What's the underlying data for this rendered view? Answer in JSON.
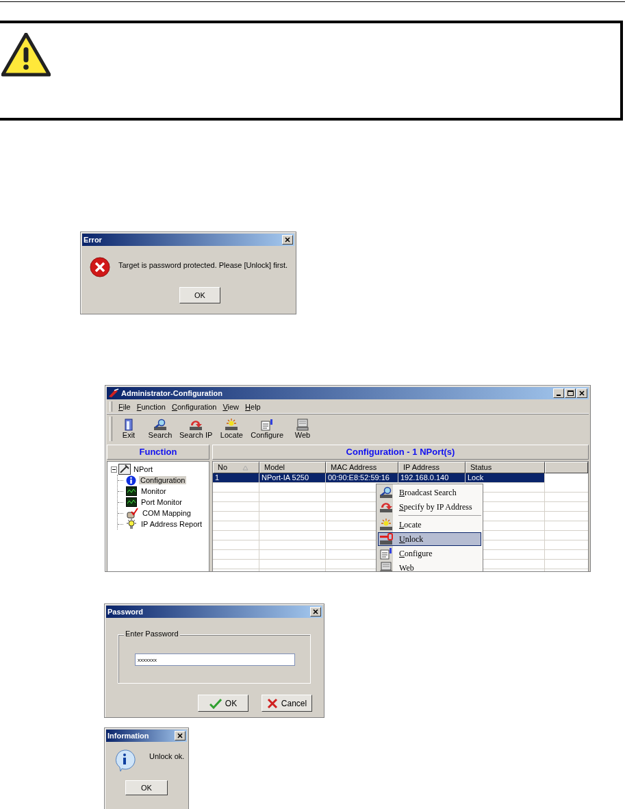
{
  "error_dialog": {
    "title": "Error",
    "message": "Target is password protected. Please [Unlock] first.",
    "button": "OK"
  },
  "admin_window": {
    "title": "Administrator-Configuration",
    "menu": [
      "File",
      "Function",
      "Configuration",
      "View",
      "Help"
    ],
    "toolbar": [
      "Exit",
      "Search",
      "Search IP",
      "Locate",
      "Configure",
      "Web"
    ],
    "function_header": "Function",
    "tree": [
      {
        "label": "NPort",
        "expanded": true,
        "selected": false,
        "children": [
          {
            "label": "Configuration",
            "selected": true
          },
          {
            "label": "Monitor",
            "selected": false
          },
          {
            "label": "Port Monitor",
            "selected": false
          },
          {
            "label": "COM Mapping",
            "selected": false
          },
          {
            "label": "IP Address Report",
            "selected": false
          }
        ]
      }
    ],
    "table_header": "Configuration - 1 NPort(s)",
    "columns": [
      {
        "label": "No",
        "sorted": true
      },
      {
        "label": "Model",
        "sorted": false
      },
      {
        "label": "MAC Address",
        "sorted": false
      },
      {
        "label": "IP Address",
        "sorted": false
      },
      {
        "label": "Status",
        "sorted": false
      }
    ],
    "rows": [
      {
        "cells": [
          "1",
          "NPort-IA 5250",
          "00:90:E8:52:59:16",
          "192.168.0.140",
          "Lock"
        ],
        "selected": true
      }
    ],
    "context_menu": [
      {
        "kind": "item",
        "label": "Broadcast Search",
        "selected": false
      },
      {
        "kind": "item",
        "label": "Specify by IP Address",
        "selected": false
      },
      {
        "kind": "separator"
      },
      {
        "kind": "item",
        "label": "Locate",
        "selected": false
      },
      {
        "kind": "item",
        "label": "Unlock",
        "selected": true
      },
      {
        "kind": "item",
        "label": "Configure",
        "selected": false
      },
      {
        "kind": "item",
        "label": "Web",
        "selected": false
      }
    ]
  },
  "password_dialog": {
    "title": "Password",
    "group_label": "Enter Password",
    "value": "xxxxxxx",
    "buttons": [
      {
        "kind": "ok",
        "label": "OK"
      },
      {
        "kind": "cancel",
        "label": "Cancel"
      }
    ]
  },
  "info_dialog": {
    "title": "Information",
    "message": "Unlock ok.",
    "button": "OK"
  }
}
